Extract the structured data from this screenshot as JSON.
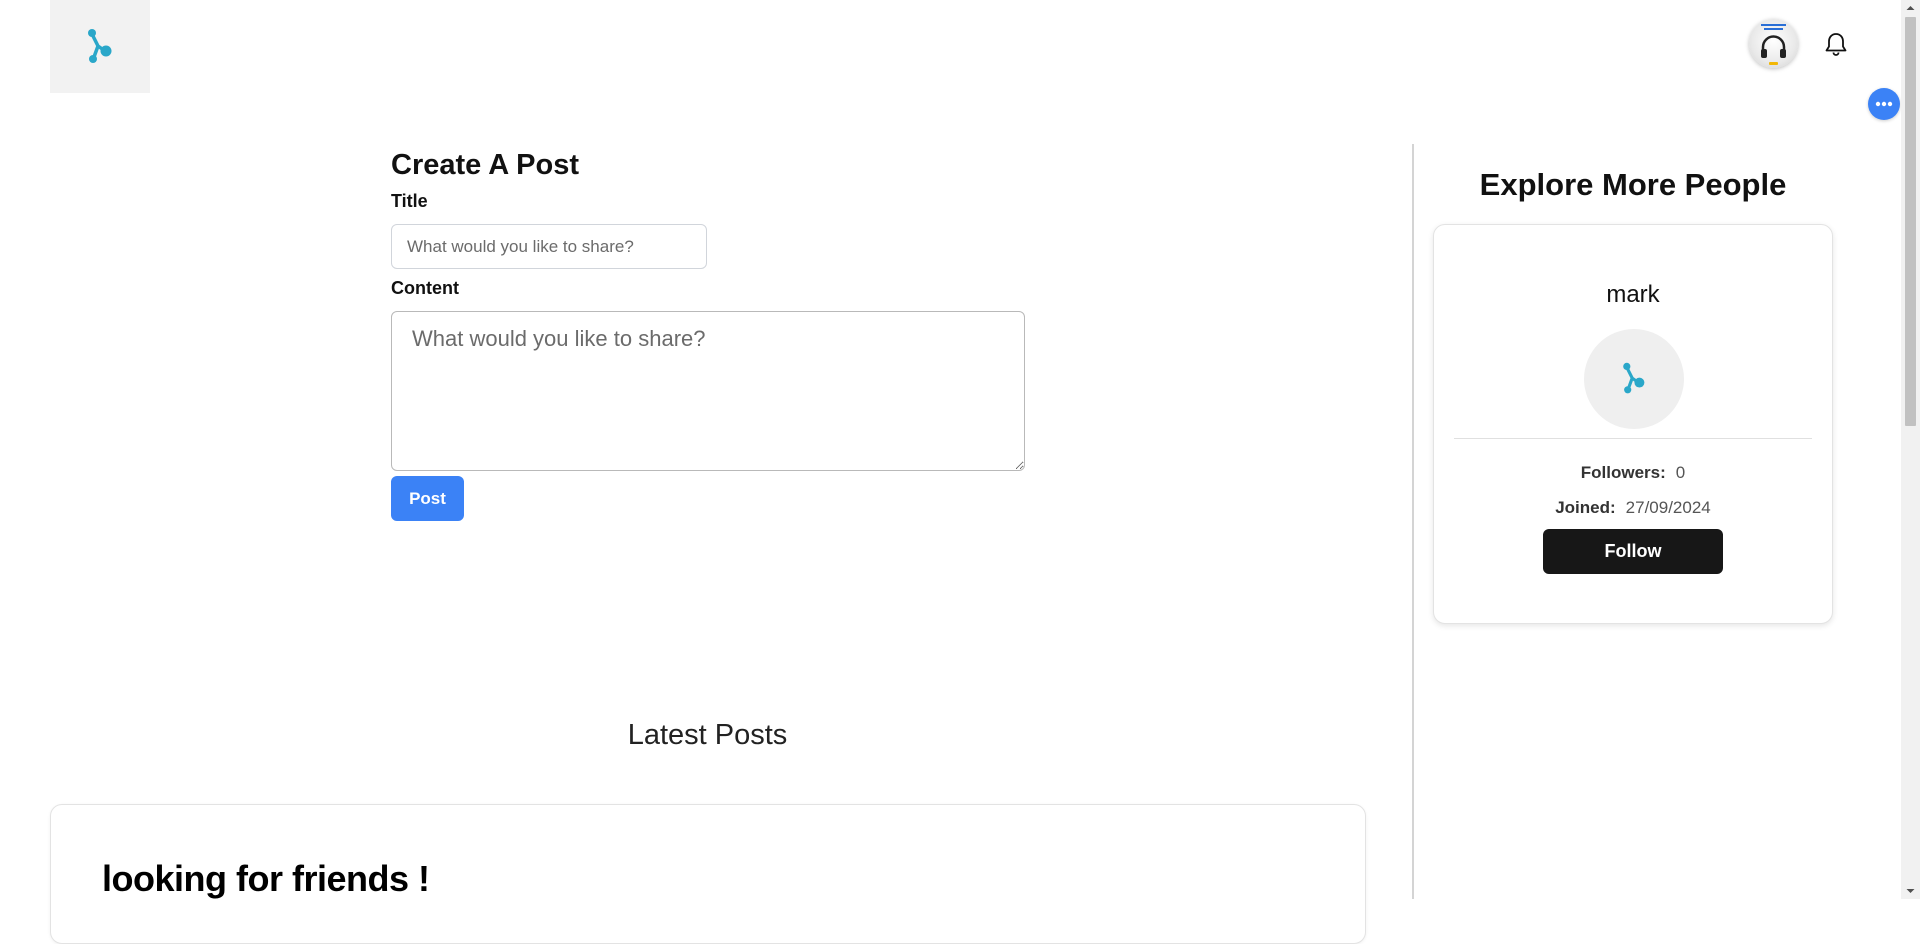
{
  "header": {
    "logo_icon": "app-logo-icon",
    "avatar_icon": "headphones-avatar-icon",
    "notification_icon": "bell-icon",
    "chat_icon": "chat-dots-icon"
  },
  "create_post": {
    "heading": "Create A Post",
    "title_label": "Title",
    "title_placeholder": "What would you like to share?",
    "title_value": "",
    "content_label": "Content",
    "content_placeholder": "What would you like to share?",
    "content_value": "",
    "post_button": "Post"
  },
  "latest_posts": {
    "heading": "Latest Posts",
    "posts": [
      {
        "title": "looking for friends !"
      }
    ]
  },
  "explore": {
    "heading": "Explore More People",
    "people": [
      {
        "name": "mark",
        "followers_label": "Followers:",
        "followers_value": "0",
        "joined_label": "Joined:",
        "joined_value": "27/09/2024",
        "follow_button": "Follow"
      }
    ]
  },
  "colors": {
    "primary_blue": "#3b82f6",
    "follow_button_bg": "#171717",
    "logo_teal": "#2aa7c9"
  }
}
